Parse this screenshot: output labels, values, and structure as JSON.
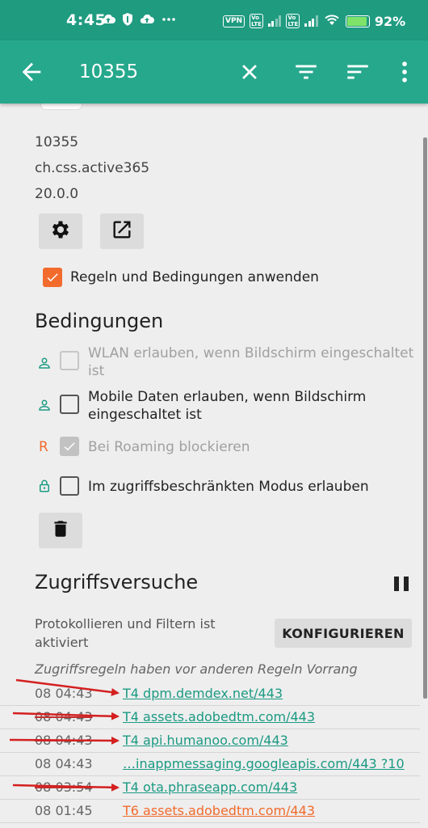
{
  "status_bar": {
    "time": "4:45",
    "icons": [
      "cloud-upload-icon",
      "shield-icon",
      "cloud-upload-icon",
      "more-dots-icon"
    ],
    "vpn": "VPN",
    "volte": "Vo\nLTE",
    "battery": "92%"
  },
  "app_bar": {
    "title": "10355",
    "back_icon": "arrow-back-icon",
    "actions": [
      "close-icon",
      "filter-icon",
      "sort-icon",
      "more-vert-icon"
    ]
  },
  "app_info": {
    "uid": "10355",
    "package": "ch.css.active365",
    "version": "20.0.0"
  },
  "buttons": {
    "settings_icon": "gear-icon",
    "open_icon": "open-external-icon",
    "delete_icon": "trash-icon"
  },
  "apply_rules": {
    "label": "Regeln und Bedingungen anwenden",
    "checked": true
  },
  "conditions": {
    "heading": "Bedingungen",
    "items": [
      {
        "icon": "person-icon",
        "label": "WLAN erlauben, wenn Bildschirm eingeschaltet ist",
        "checked": false,
        "enabled": false
      },
      {
        "icon": "person-icon",
        "label": "Mobile Daten erlauben, wenn Bildschirm eingeschaltet ist",
        "checked": false,
        "enabled": true
      },
      {
        "icon": "R",
        "label": "Bei Roaming blockieren",
        "checked": true,
        "enabled": false
      },
      {
        "icon": "lock-icon",
        "label": "Im zugriffsbeschränkten Modus erlauben",
        "checked": false,
        "enabled": true
      }
    ]
  },
  "access_attempts": {
    "heading": "Zugriffsversuche",
    "pause_icon": "pause-icon",
    "note": "Protokollieren und Filtern ist aktiviert",
    "configure_label": "KONFIGURIEREN",
    "rule_note": "Zugriffsregeln haben vor anderen Regeln Vorrang",
    "log": [
      {
        "time": "08 04:43",
        "dest": "T4 dpm.demdex.net/443",
        "strike": false,
        "blocked": false
      },
      {
        "time": "08 04:43",
        "dest": "T4 assets.adobedtm.com/443",
        "strike": true,
        "blocked": false
      },
      {
        "time": "08 04:43",
        "dest": "T4 api.humanoo.com/443",
        "strike": true,
        "blocked": false
      },
      {
        "time": "08 04:43",
        "dest": "…inappmessaging.googleapis.com/443 ?10",
        "strike": false,
        "blocked": false
      },
      {
        "time": "08 03:54",
        "dest": "T4 ota.phraseapp.com/443",
        "strike": true,
        "blocked": false
      },
      {
        "time": "08 01:45",
        "dest": "T6 assets.adobedtm.com/443",
        "strike": false,
        "blocked": true
      }
    ]
  },
  "colors": {
    "status_bar": "#1f9b80",
    "app_bar": "#26a88c",
    "accent_orange": "#f26b2d",
    "link_teal": "#1b9a83",
    "arrow_red": "#d42020"
  }
}
